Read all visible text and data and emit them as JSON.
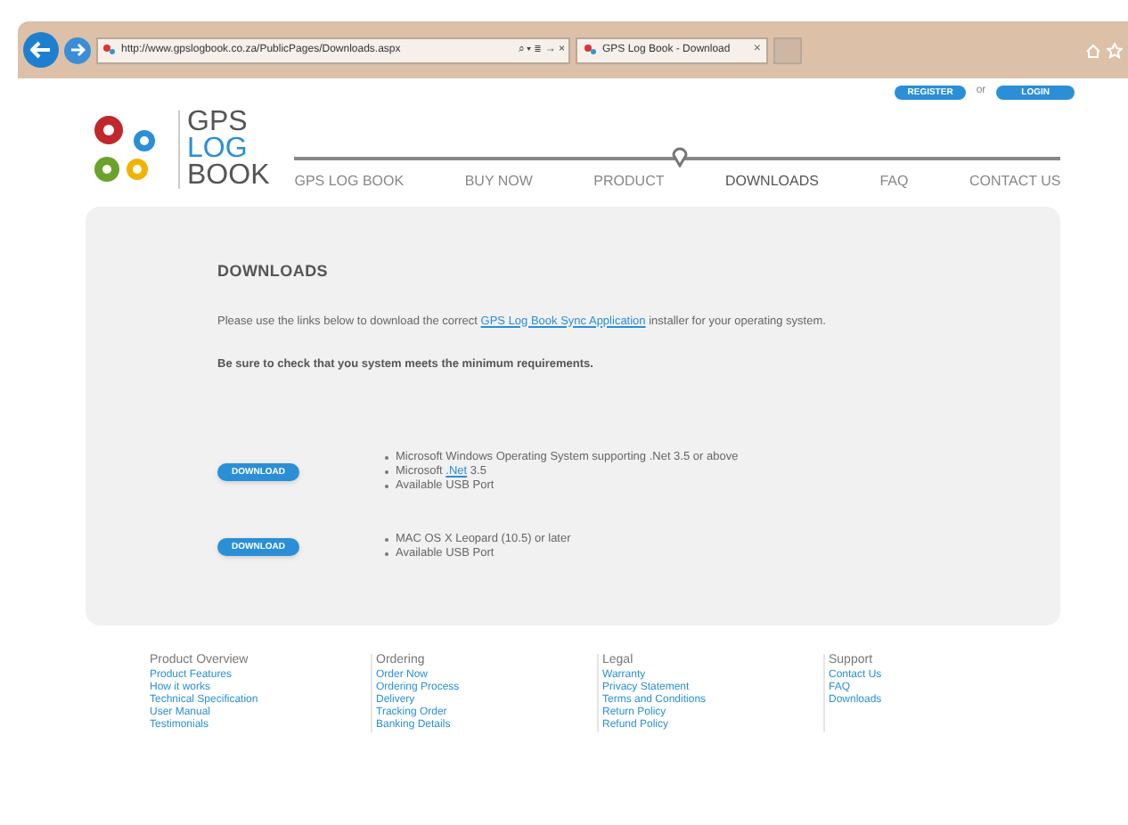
{
  "browser": {
    "address": "http://www.gpslogbook.co.za/PublicPages/Downloads.aspx",
    "address_controls": "⌕ ▾ ≣ → ×",
    "tabs": [
      {
        "title": "GPS Log Book - Download",
        "close": "×",
        "selected": true
      }
    ]
  },
  "header": {
    "register": "REGISTER",
    "or": "or",
    "login": "LOGIN",
    "logo": [
      "GPS",
      "LOG",
      "BOOK"
    ],
    "nav": [
      {
        "label": "GPS LOG BOOK",
        "selected": false
      },
      {
        "label": "BUY NOW",
        "selected": false
      },
      {
        "label": "PRODUCT",
        "selected": false
      },
      {
        "label": "DOWNLOADS",
        "selected": true
      },
      {
        "label": "FAQ",
        "selected": false
      },
      {
        "label": "CONTACT US",
        "selected": false
      }
    ]
  },
  "content": {
    "heading": "DOWNLOADS",
    "intro": [
      {
        "kind": "plain",
        "text": "Please use the links below to download the correct "
      },
      {
        "kind": "link",
        "text": "GPS Log Book Sync Application"
      },
      {
        "kind": "plain",
        "text": " installer for your operating system."
      }
    ],
    "note": "Be sure to check that you system meets the minimum requirements.",
    "downloads": [
      {
        "button": "DOWNLOAD",
        "requirements": [
          [
            {
              "kind": "plain",
              "text": "Microsoft Windows Operating System supporting .Net 3.5 or above"
            }
          ],
          [
            {
              "kind": "plain",
              "text": "Microsoft "
            },
            {
              "kind": "link",
              "text": ".Net"
            },
            {
              "kind": "plain",
              "text": " 3.5"
            }
          ],
          [
            {
              "kind": "plain",
              "text": "Available USB Port"
            }
          ]
        ]
      },
      {
        "button": "DOWNLOAD",
        "requirements": [
          [
            {
              "kind": "plain",
              "text": "MAC OS X Leopard (10.5) or later"
            }
          ],
          [
            {
              "kind": "plain",
              "text": "Available USB Port"
            }
          ]
        ]
      }
    ]
  },
  "footer": [
    {
      "title": "Product Overview",
      "links": [
        "Product Features",
        "How it works",
        "Technical Specification",
        "User Manual",
        "Testimonials"
      ]
    },
    {
      "title": "Ordering",
      "links": [
        "Order Now",
        "Ordering Process",
        "Delivery",
        "Tracking Order",
        "Banking Details"
      ]
    },
    {
      "title": "Legal",
      "links": [
        "Warranty",
        "Privacy Statement",
        "Terms and Conditions",
        "Return Policy",
        "Refund Policy"
      ]
    },
    {
      "title": "Support",
      "links": [
        "Contact Us",
        "FAQ",
        "Downloads"
      ]
    }
  ]
}
